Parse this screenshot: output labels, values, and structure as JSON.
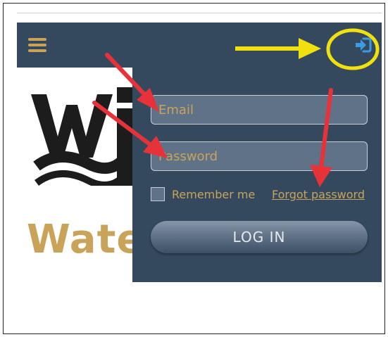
{
  "navbar": {
    "menu_icon": "hamburger-menu-icon",
    "login_icon": "sign-in-icon"
  },
  "brand": {
    "logo_letters": "Wi",
    "text": "Wate"
  },
  "login_form": {
    "email_placeholder": "Email",
    "password_placeholder": "Password",
    "remember_label": "Remember me",
    "remember_checked": false,
    "forgot_label": "Forgot password",
    "login_label": "LOG IN"
  },
  "colors": {
    "navbar_bg": "#34495e",
    "accent_gold": "#c9a35a",
    "login_icon": "#3c9be0",
    "annotation_red": "#e8323a",
    "annotation_yellow": "#f0e010"
  }
}
